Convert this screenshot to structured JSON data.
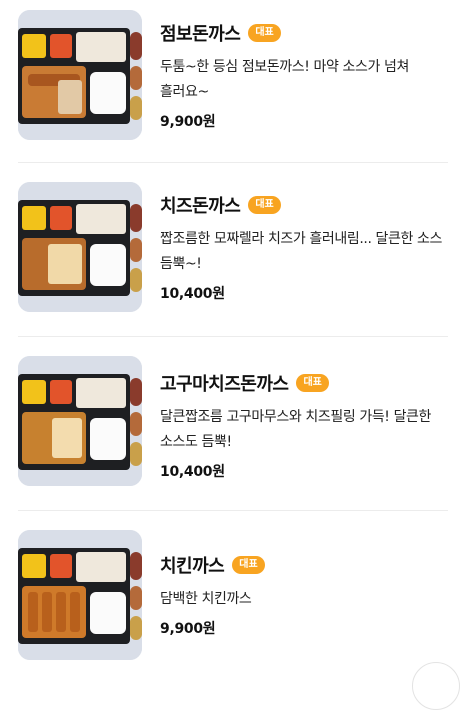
{
  "menu": {
    "items": [
      {
        "name": "점보돈까스",
        "badge": "대표",
        "description": "두툼~한 등심 점보돈까스! 마약 소스가 넘쳐 흘러요~",
        "price": "9,900원"
      },
      {
        "name": "치즈돈까스",
        "badge": "대표",
        "description": "짭조름한 모짜렐라 치즈가 흘러내림... 달큰한 소스 듬뿍~!",
        "price": "10,400원"
      },
      {
        "name": "고구마치즈돈까스",
        "badge": "대표",
        "description": "달큰짭조름 고구마무스와 치즈필링 가득! 달큰한 소스도 듬뿍!",
        "price": "10,400원"
      },
      {
        "name": "치킨까스",
        "badge": "대표",
        "description": "담백한 치킨까스",
        "price": "9,900원"
      }
    ]
  },
  "icons": {
    "scroll_top": "scroll-top-icon"
  },
  "colors": {
    "badge": "#f8a421"
  }
}
